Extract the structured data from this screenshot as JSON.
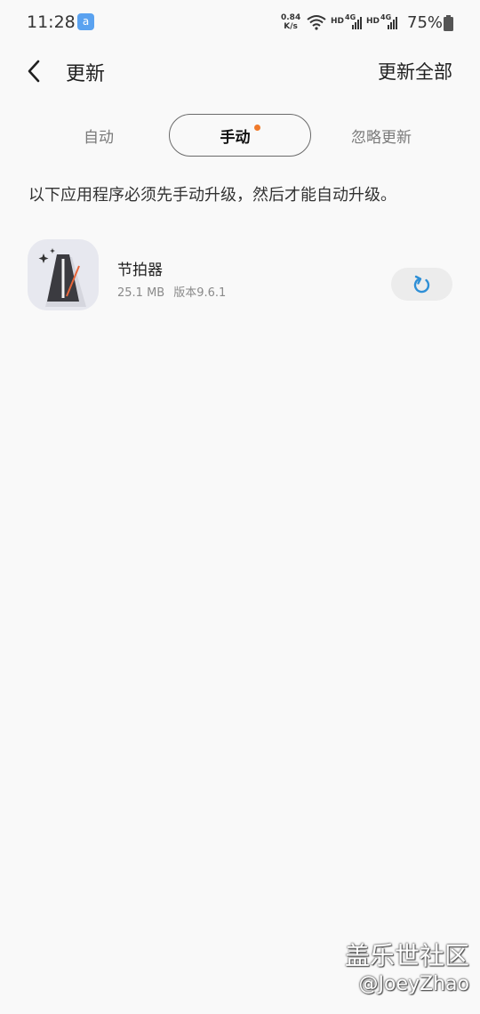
{
  "status_bar": {
    "time": "11:28",
    "app_icon_glyph": "a",
    "net_speed_value": "0.84",
    "net_speed_unit": "K/s",
    "hd1": "HD",
    "hd2": "HD",
    "battery": "75%",
    "sig_label_1": "4G",
    "sig_label_2": "4G"
  },
  "header": {
    "title": "更新",
    "update_all": "更新全部"
  },
  "tabs": [
    {
      "label": "自动"
    },
    {
      "label": "手动",
      "selected": true,
      "has_badge": true
    },
    {
      "label": "忽略更新"
    }
  ],
  "notice": "以下应用程序必须先手动升级，然后才能自动升级。",
  "apps": [
    {
      "name": "节拍器",
      "size": "25.1 MB",
      "version": "版本9.6.1",
      "icon": "metronome-icon",
      "action_icon": "refresh-icon"
    }
  ],
  "watermark": {
    "line1": "盖乐世社区",
    "line2": "@JoeyZhao"
  },
  "colors": {
    "background": "#f9f9f9",
    "badge": "#f07a2b",
    "accent": "#2e8fd6"
  }
}
